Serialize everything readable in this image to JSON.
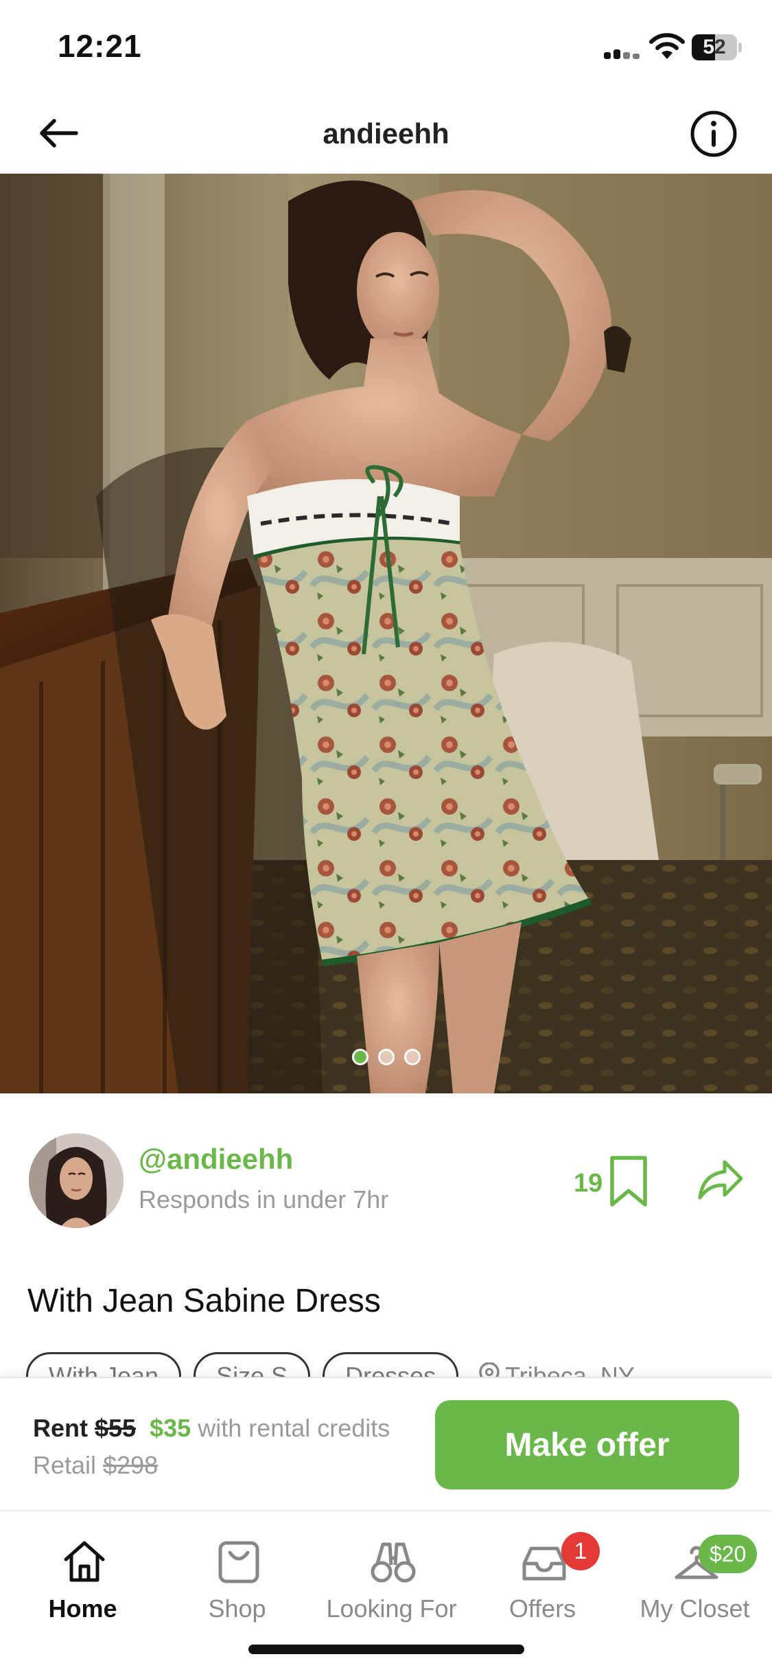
{
  "status_bar": {
    "time": "12:21",
    "battery": "52",
    "battery_fill": 0.52
  },
  "header": {
    "title": "andieehh",
    "back_icon": "arrow-left-icon",
    "info_icon": "info-circle-icon"
  },
  "photo": {
    "page_count": 3,
    "active_page": 1
  },
  "seller": {
    "handle": "@andieehh",
    "response": "Responds in under 7hr",
    "save_count": "19"
  },
  "item": {
    "title": "With Jean Sabine Dress",
    "tags": [
      "With Jean",
      "Size S",
      "Dresses"
    ],
    "location": "Tribeca, NY"
  },
  "pricing": {
    "rent_label": "Rent",
    "rent_original": "$55",
    "rent_discounted": "$35",
    "rent_note": "with rental credits",
    "retail_label": "Retail",
    "retail_price": "$298",
    "offer_button": "Make offer"
  },
  "tabs": [
    {
      "label": "Home",
      "icon": "home-icon",
      "active": true
    },
    {
      "label": "Shop",
      "icon": "shopping-bag-icon"
    },
    {
      "label": "Looking For",
      "icon": "binoculars-icon"
    },
    {
      "label": "Offers",
      "icon": "inbox-tray-icon",
      "badge": "1"
    },
    {
      "label": "My Closet",
      "icon": "hanger-icon",
      "badge": "$20"
    }
  ],
  "colors": {
    "accent": "#6bb84a",
    "badge": "#e53935"
  }
}
